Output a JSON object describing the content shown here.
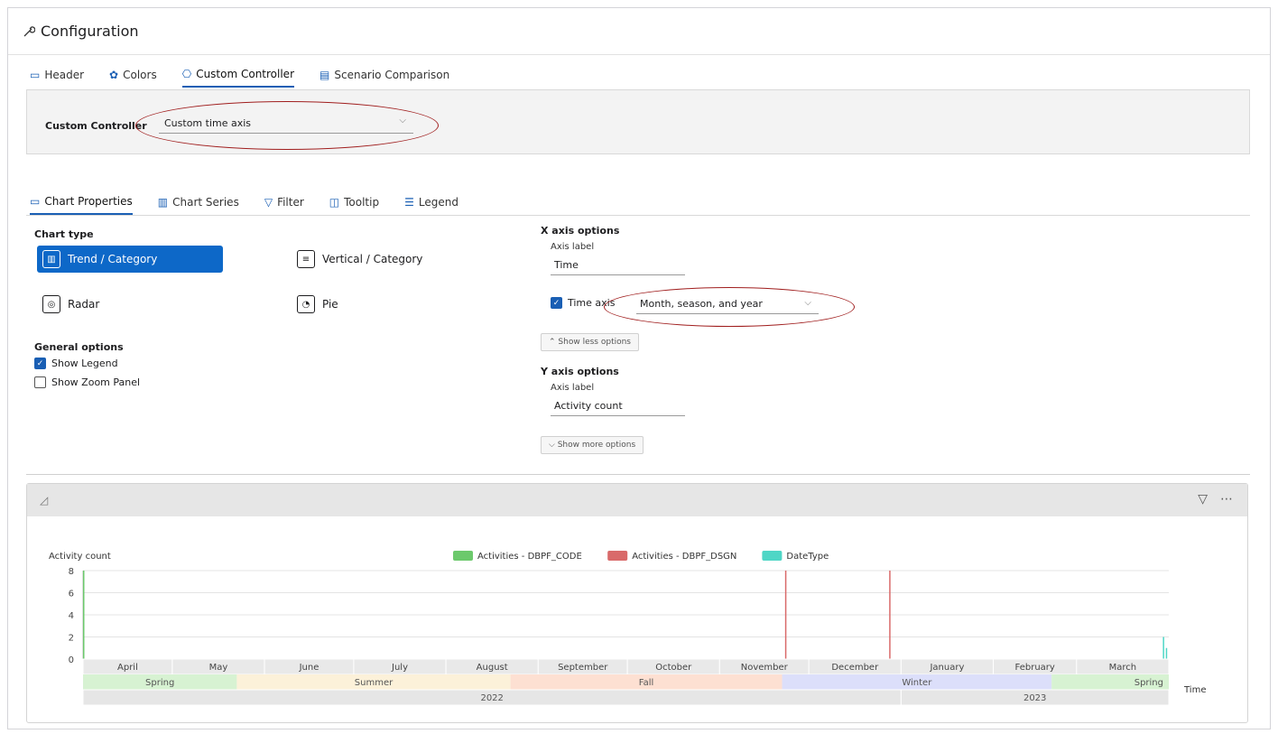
{
  "panel": {
    "title": "Configuration",
    "icon": "wrench-icon"
  },
  "top_tabs": [
    {
      "label": "Header",
      "icon": "window-icon",
      "active": false
    },
    {
      "label": "Colors",
      "icon": "palette-icon",
      "active": false
    },
    {
      "label": "Custom Controller",
      "icon": "controller-icon",
      "active": true
    },
    {
      "label": "Scenario Comparison",
      "icon": "compare-icon",
      "active": false
    }
  ],
  "custom_controller": {
    "label": "Custom Controller",
    "value": "Custom time axis"
  },
  "sub_tabs": [
    {
      "label": "Chart Properties",
      "icon": "properties-icon",
      "active": true
    },
    {
      "label": "Chart Series",
      "icon": "series-icon",
      "active": false
    },
    {
      "label": "Filter",
      "icon": "filter-icon",
      "active": false
    },
    {
      "label": "Tooltip",
      "icon": "tooltip-icon",
      "active": false
    },
    {
      "label": "Legend",
      "icon": "legend-icon",
      "active": false
    }
  ],
  "chart_type": {
    "label": "Chart type",
    "options": [
      {
        "label": "Trend / Category",
        "selected": true
      },
      {
        "label": "Vertical / Category",
        "selected": false
      },
      {
        "label": "Radar",
        "selected": false
      },
      {
        "label": "Pie",
        "selected": false
      }
    ]
  },
  "general_options": {
    "label": "General options",
    "show_legend": {
      "label": "Show Legend",
      "checked": true
    },
    "show_zoom": {
      "label": "Show Zoom Panel",
      "checked": false
    }
  },
  "x_axis": {
    "title": "X axis options",
    "axis_label_caption": "Axis label",
    "axis_label_value": "Time",
    "time_axis": {
      "label": "Time axis",
      "checked": true,
      "value": "Month, season, and year"
    },
    "toggle": "Show less options"
  },
  "y_axis": {
    "title": "Y axis options",
    "axis_label_caption": "Axis label",
    "axis_label_value": "Activity count",
    "toggle": "Show more options"
  },
  "colors": {
    "accent": "#0d68c8",
    "code": "#6cc96c",
    "dsgn": "#d96a6a",
    "datetype": "#4fd6c6",
    "annotation": "#a01e1e"
  },
  "chart_data": {
    "type": "bar",
    "ylabel": "Activity count",
    "xlabel": "Time",
    "ylim": [
      0,
      8
    ],
    "yticks": [
      0,
      2,
      4,
      6,
      8
    ],
    "legend": [
      "Activities - DBPF_CODE",
      "Activities - DBPF_DSGN",
      "DateType"
    ],
    "months": [
      "April",
      "May",
      "June",
      "July",
      "August",
      "September",
      "October",
      "November",
      "December",
      "January",
      "February",
      "March"
    ],
    "seasons": [
      "Spring",
      "Summer",
      "Fall",
      "Winter",
      "Spring"
    ],
    "years": [
      "2022",
      "2023"
    ],
    "series": [
      {
        "name": "Activities - DBPF_CODE",
        "points": [
          {
            "x": "2022-04-01",
            "y": 8
          }
        ]
      },
      {
        "name": "Activities - DBPF_DSGN",
        "points": [
          {
            "x": "2022-11-23",
            "y": 8
          },
          {
            "x": "2022-12-28",
            "y": 8
          }
        ]
      },
      {
        "name": "DateType",
        "points": [
          {
            "x": "2023-03-30",
            "y": 2
          },
          {
            "x": "2023-03-31",
            "y": 1
          }
        ]
      }
    ]
  }
}
